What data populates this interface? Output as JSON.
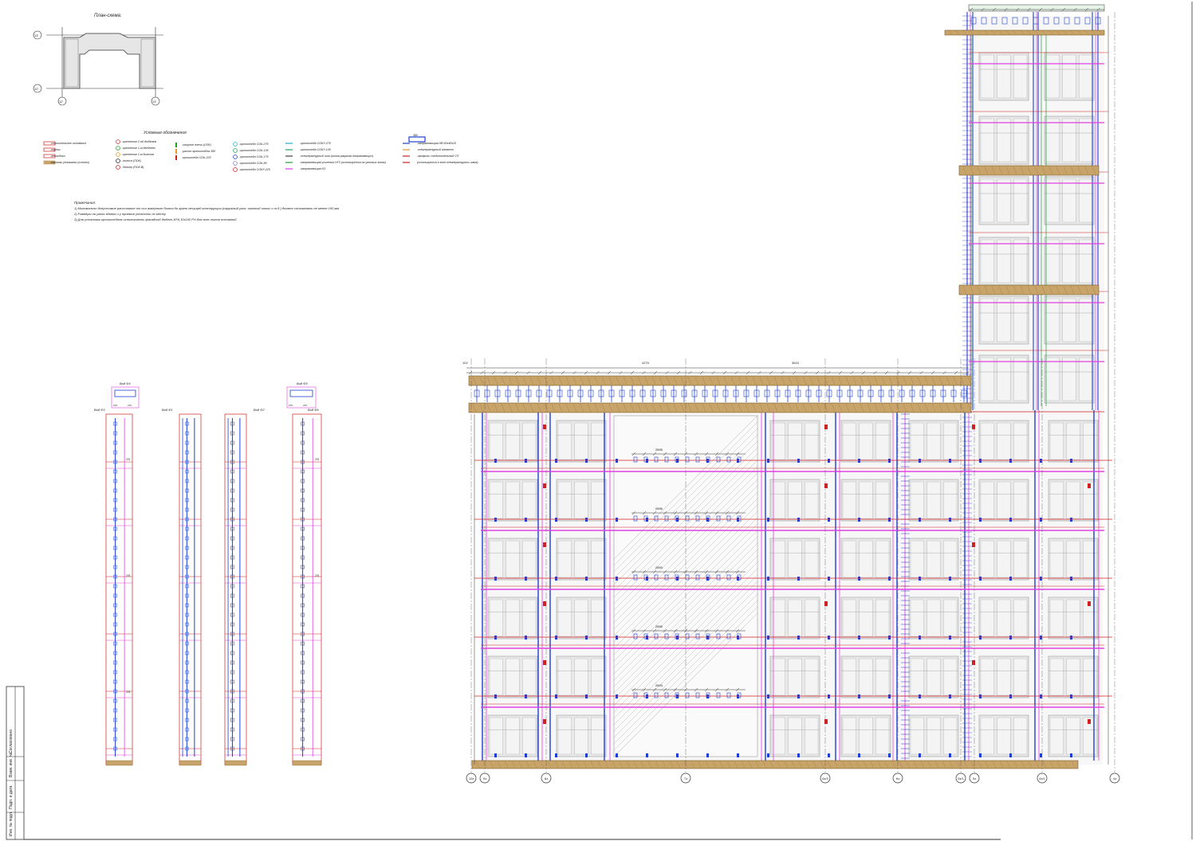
{
  "scheme": {
    "title": "План-схема:",
    "row_labels": [
      "13'",
      "12'"
    ],
    "col_labels": [
      "12'",
      "13'"
    ]
  },
  "legend": {
    "title": "Условные обозначения",
    "col1": [
      {
        "label": "-строительное основание",
        "color": "#d22020"
      },
      {
        "label": "-карниз",
        "color": "#d22020"
      },
      {
        "label": "-гениобоки",
        "color": "#d22020"
      },
      {
        "label": "-карнизы (показаны условно)",
        "color": "#c8a46a"
      }
    ],
    "col2": [
      {
        "label": "-крепление 2-ой дюбелем",
        "color": "#e03030"
      },
      {
        "label": "-крепление 1-м дюбелем",
        "color": "#20a020"
      },
      {
        "label": "-крепление 1-м болтом",
        "color": "#e09a20"
      },
      {
        "label": "-полоса (ПОК)",
        "color": "#222222"
      },
      {
        "label": "-блокер (ПОК-В)",
        "color": "#d22020"
      }
    ],
    "col3": [
      {
        "label": "-опорное плечо (ОПК)",
        "color": "#20a020"
      },
      {
        "label": "-раскос кронштейна 380",
        "color": "#e09a20"
      },
      {
        "label": "-кронштейн СОК-225",
        "color": "#d22020"
      }
    ],
    "col4": [
      {
        "label": "-кронштейн СОК-275",
        "color": "#20b0c0"
      },
      {
        "label": "-кронштейн СОК-135",
        "color": "#20a060"
      },
      {
        "label": "-кронштейн СОК-175",
        "color": "#2040c0"
      },
      {
        "label": "-кронштейн СОК-85",
        "color": "#8080c0"
      },
      {
        "label": "-кронштейн СОКУ-225",
        "color": "#d22020"
      }
    ],
    "col5": [
      {
        "label": "-кронштейн СОКУ-275",
        "color": "#20b0c0"
      },
      {
        "label": "-кронштейн СОКУ-135",
        "color": "#20a060"
      },
      {
        "label": "-температурный шов (линия разрыва направляющих)",
        "color": "#444444"
      },
      {
        "label": "-направляющая усиления НГЗ (используется на угловых зонах)",
        "color": "#2a9a40"
      },
      {
        "label": "-направляющая НЗ",
        "color": "#e040e0"
      }
    ],
    "col6": [
      {
        "label": "-направляющая НВ 60х40х20",
        "color": "#2040c0"
      },
      {
        "label": "-температурный элемент",
        "color": "#e09a20"
      },
      {
        "label": "-профиль соединительный СП",
        "color": "#d22020"
      },
      {
        "label": "(используется в зоне температурных швов)",
        "color": "#d22020"
      }
    ],
    "tag_380": "380"
  },
  "notes": {
    "title": "Примечания:",
    "items": [
      "1) Минимально допустимое расстояние от оси анкерного болта до грани несущей конструкции (наружный угол, оконный откос и т.д.) должно составлять не менее 100 мм",
      "2) Размеры на углах здания и у проемов уточнить по месту",
      "3) Для установки кронштейнов использовать фасадный дюбель EFA 10х100 FH для всех типов оснований"
    ]
  },
  "views": [
    {
      "title": "Вид Ф3",
      "dims": [
        "276",
        "276",
        "276"
      ]
    },
    {
      "title": "Вид Ф4",
      "dims": [
        "270",
        "270"
      ]
    },
    {
      "title": "Вид Ф1",
      "dims": []
    },
    {
      "title": "Вид Ф2",
      "dims": []
    },
    {
      "title": "Вид Ф5",
      "dims": [
        "270",
        "270"
      ]
    },
    {
      "title": "Вид Ф6",
      "dims": [
        "276",
        "276"
      ]
    }
  ],
  "elevation": {
    "axes": [
      "10з",
      "9з",
      "8з",
      "7з",
      "6з/1",
      "6з",
      "5з/1",
      "5з",
      "4з/1",
      "4з"
    ],
    "top_dims": [
      "4275",
      "3624"
    ],
    "left_dim": "102",
    "mid_dims": [
      "2895",
      "2896",
      "2893",
      "2896",
      "2893"
    ]
  },
  "stamp": {
    "labels": [
      "Согласовано",
      "Взам. инв. №",
      "Подп. и дата",
      "Инв. № подл."
    ]
  },
  "colors": {
    "frame": "#222222",
    "red": "#d22020",
    "blue": "#1f3fd0",
    "magenta": "#e040e0",
    "green": "#1fa040",
    "wood": "#c8a46a",
    "window": "#cfcfcf"
  }
}
